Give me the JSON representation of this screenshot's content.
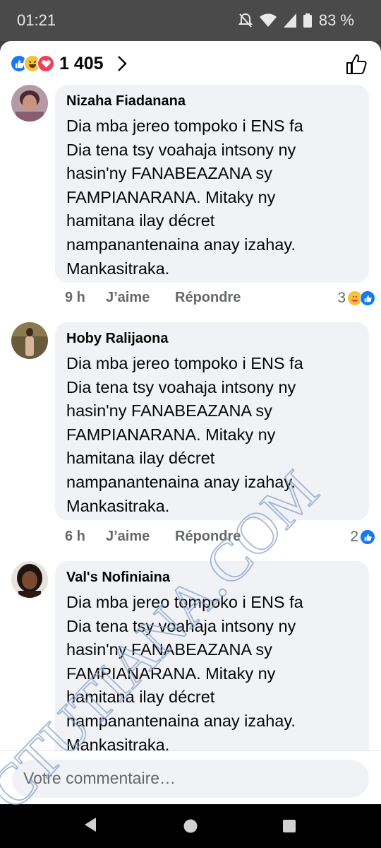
{
  "status_bar": {
    "time": "01:21",
    "battery": "83 %"
  },
  "reactions": {
    "count": "1 405",
    "icons": [
      "like-icon",
      "haha-icon",
      "love-icon"
    ]
  },
  "comments": [
    {
      "author": "Nizaha Fiadanana",
      "text_lines": [
        "Dia mba jereo tompoko i ENS fa",
        "Dia tena tsy voahaja intsony ny",
        "hasin'ny FANABEAZANA sy",
        "FAMPIANARANA. Mitaky ny",
        "hamitana ilay décret",
        "nampanantenaina anay izahay.",
        "Mankasitraka."
      ],
      "time": "9 h",
      "like_label": "J’aime",
      "reply_label": "Répondre",
      "reaction_count": "3"
    },
    {
      "author": "Hoby Ralijaona",
      "text_lines": [
        "Dia mba jereo tompoko i ENS fa",
        "Dia tena tsy voahaja intsony ny",
        "hasin'ny FANABEAZANA sy",
        "FAMPIANARANA. Mitaky ny",
        "hamitana ilay décret",
        "nampanantenaina anay izahay.",
        "Mankasitraka."
      ],
      "time": "6 h",
      "like_label": "J’aime",
      "reply_label": "Répondre",
      "reaction_count": "2"
    },
    {
      "author": "Val's Nofiniaina",
      "text_lines": [
        "Dia mba jereo tompoko i ENS fa",
        "Dia tena tsy voahaja intsony ny",
        "hasin'ny FANABEAZANA sy",
        "FAMPIANARANA. Mitaky ny",
        "hamitana ilay décret",
        "nampanantenaina anay izahay.",
        "Mankasitraka."
      ]
    }
  ],
  "input": {
    "placeholder": "Votre commentaire…"
  },
  "watermark": "CTUTIANA.COM",
  "colors": {
    "accent": "#1877f2",
    "bubble": "#f0f2f5",
    "secondary_text": "#65676b"
  }
}
